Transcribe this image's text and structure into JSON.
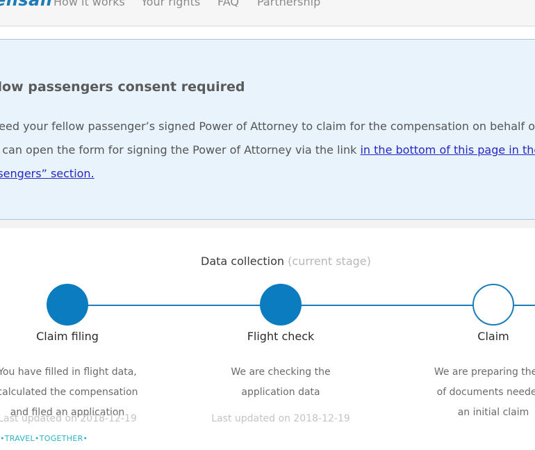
{
  "header": {
    "logo_text": "ensair",
    "nav": [
      {
        "label": "How it works"
      },
      {
        "label": "Your rights"
      },
      {
        "label": "FAQ"
      },
      {
        "label": "Partnership"
      }
    ]
  },
  "notice": {
    "title": "llow passengers consent required",
    "line1": " need your fellow passenger’s signed Power of Attorney to claim for the compensation on behalf o",
    "line2_text": "u can open the form for signing the Power of Attorney via the link ",
    "line2_link": "in the bottom of this page in the",
    "line3_link": "ssengers” section."
  },
  "progress": {
    "heading": "Data collection",
    "heading_sub": "(current stage)",
    "steps": [
      {
        "title": "Claim filing",
        "state": "completed",
        "desc": [
          "You have filled in flight data,",
          "calculated the compensation",
          "and filed an application"
        ],
        "updated": "Last updated on 2018-12-19"
      },
      {
        "title": "Flight check",
        "state": "completed",
        "desc": [
          "We are checking the",
          "application data"
        ],
        "updated": "Last updated on 2018-12-19"
      },
      {
        "title": "Claim",
        "state": "pending",
        "desc": [
          "We are preparing the pa",
          "of documents needed t",
          "an initial claim"
        ],
        "updated": ""
      }
    ]
  },
  "watermark": "•TRAVEL•TOGETHER•",
  "colors": {
    "accent": "#0b7cbf",
    "notice_bg": "#e8f3fc",
    "link": "#2626c7",
    "watermark": "#2fb2c9"
  }
}
